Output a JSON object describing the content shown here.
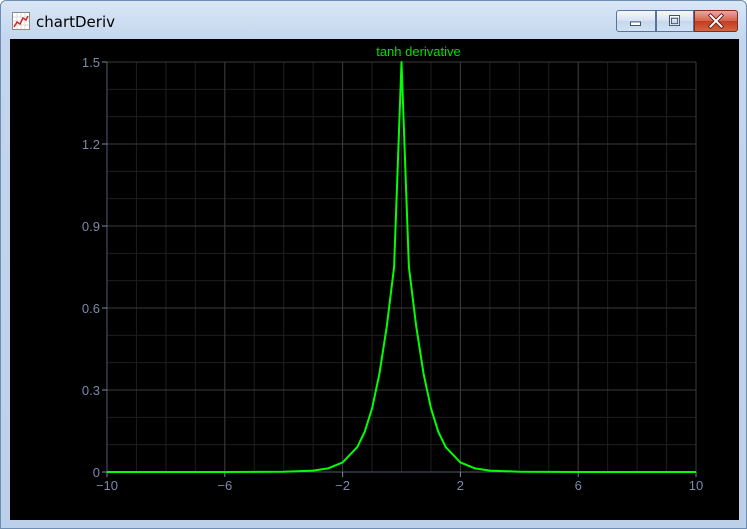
{
  "window": {
    "title": "chartDeriv",
    "icon": "chart-app-icon"
  },
  "controls": {
    "minimize": "minimize-icon",
    "maximize": "maximize-icon",
    "close": "close-icon"
  },
  "colors": {
    "background": "#000000",
    "curve": "#00ff00",
    "title": "#00e000",
    "grid_major": "#3a3a3a",
    "grid_minor": "#1e1e1e",
    "ticks": "#7a8aa8"
  },
  "chart_data": {
    "type": "line",
    "title": "tanh derivative",
    "xlabel": "",
    "ylabel": "",
    "xlim": [
      -10,
      10
    ],
    "ylim": [
      0,
      1.5
    ],
    "x_ticks": [
      "−10",
      "−6",
      "−2",
      "2",
      "6",
      "10"
    ],
    "y_ticks": [
      "0",
      "0.3",
      "0.6",
      "0.9",
      "1.2",
      "1.5"
    ],
    "grid": true,
    "series": [
      {
        "x": [
          -10,
          -8,
          -6,
          -4,
          -3,
          -2.5,
          -2,
          -1.5,
          -1.25,
          -1,
          -0.75,
          -0.5,
          -0.25,
          0,
          0.25,
          0.5,
          0.75,
          1,
          1.25,
          1.5,
          2,
          2.5,
          3,
          4,
          6,
          8,
          10
        ],
        "values": [
          0,
          0,
          0,
          0.001,
          0.005,
          0.013,
          0.035,
          0.091,
          0.147,
          0.233,
          0.359,
          0.533,
          0.75,
          1.5,
          0.75,
          0.533,
          0.359,
          0.233,
          0.147,
          0.091,
          0.035,
          0.013,
          0.005,
          0.001,
          0,
          0,
          0
        ]
      }
    ]
  }
}
